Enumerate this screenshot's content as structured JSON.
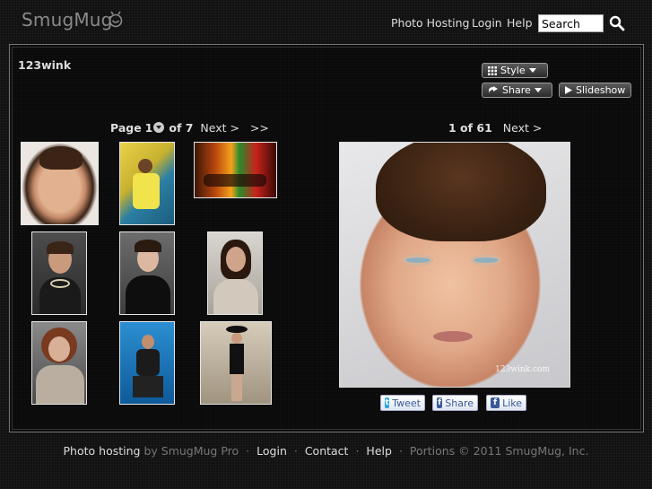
{
  "header": {
    "logo_text": "SmugMug",
    "nav": [
      "Photo Hosting",
      "Login",
      "Help"
    ],
    "search_placeholder": "Search"
  },
  "gallery": {
    "title": "123wink",
    "style_label": "Style",
    "share_label": "Share",
    "slideshow_label": "Slideshow"
  },
  "thumb_pager": {
    "page_word": "Page",
    "current": "1",
    "of_word": "of 7",
    "next_label": "Next >",
    "last_label": ">>"
  },
  "photo_pager": {
    "position": "1 of 61",
    "next_label": "Next >"
  },
  "main_photo": {
    "watermark": "123wink.com"
  },
  "social": {
    "tweet": "Tweet",
    "share": "Share",
    "like": "Like"
  },
  "footer": {
    "photo_hosting": "Photo hosting",
    "by_text": "by SmugMug Pro",
    "login": "Login",
    "contact": "Contact",
    "help": "Help",
    "copyright": "Portions © 2011 SmugMug, Inc."
  },
  "colors": {
    "background": "#111111",
    "panel_border": "#777777",
    "text": "#dddddd",
    "muted": "#777777",
    "social_text": "#3b5a99"
  }
}
